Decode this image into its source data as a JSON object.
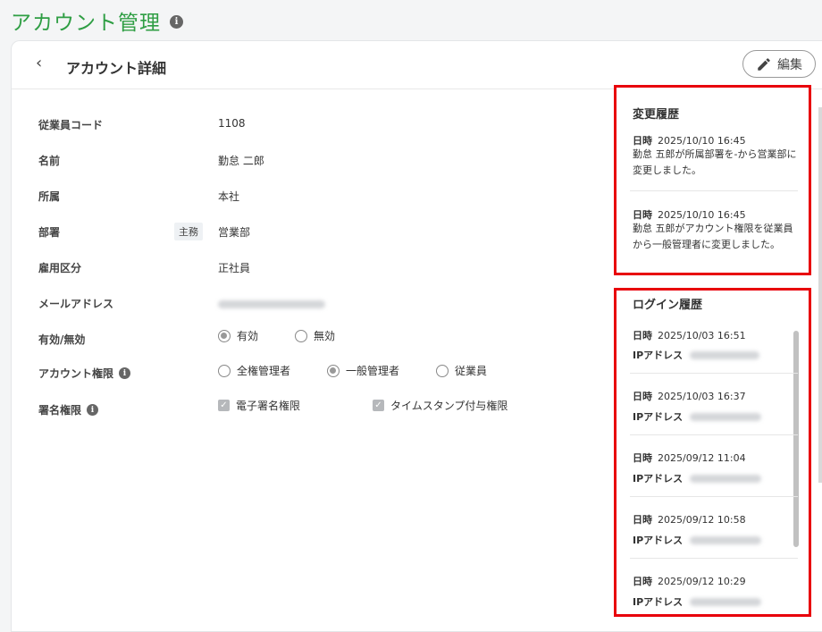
{
  "page": {
    "title": "アカウント管理",
    "info_icon": "i"
  },
  "card": {
    "back_icon": "‹",
    "title": "アカウント詳細",
    "edit_label": "編集"
  },
  "fields": {
    "employee_code": {
      "label": "従業員コード",
      "value": "1108"
    },
    "name": {
      "label": "名前",
      "value": "勤怠 二郎"
    },
    "affiliation": {
      "label": "所属",
      "value": "本社"
    },
    "department": {
      "label": "部署",
      "tag": "主務",
      "value": "営業部"
    },
    "employment_type": {
      "label": "雇用区分",
      "value": "正社員"
    },
    "email": {
      "label": "メールアドレス"
    },
    "enabled": {
      "label": "有効/無効",
      "options": [
        "有効",
        "無効"
      ],
      "selected": "有効"
    },
    "account_permission": {
      "label": "アカウント権限",
      "options": [
        "全権管理者",
        "一般管理者",
        "従業員"
      ],
      "selected": "一般管理者"
    },
    "signature_permission": {
      "label": "署名権限",
      "options": [
        "電子署名権限",
        "タイムスタンプ付与権限"
      ]
    }
  },
  "change_history": {
    "title": "変更履歴",
    "entries": [
      {
        "label": "日時",
        "datetime": "2025/10/10 16:45",
        "text": "勤怠 五郎が所属部署を-から営業部に変更しました。"
      },
      {
        "label": "日時",
        "datetime": "2025/10/10 16:45",
        "text": "勤怠 五郎がアカウント権限を従業員から一般管理者に変更しました。"
      }
    ]
  },
  "login_history": {
    "title": "ログイン履歴",
    "ip_label": "IPアドレス",
    "entries": [
      {
        "label": "日時",
        "datetime": "2025/10/03 16:51"
      },
      {
        "label": "日時",
        "datetime": "2025/10/03 16:37"
      },
      {
        "label": "日時",
        "datetime": "2025/09/12 11:04"
      },
      {
        "label": "日時",
        "datetime": "2025/09/12 10:58"
      },
      {
        "label": "日時",
        "datetime": "2025/09/12 10:29"
      }
    ]
  },
  "colors": {
    "brand": "#2f9e44",
    "highlight": "#e8000b"
  },
  "icons": {
    "edit": "pencil-icon",
    "back": "chevron-left-icon",
    "info": "info-icon",
    "check": "check-icon"
  }
}
